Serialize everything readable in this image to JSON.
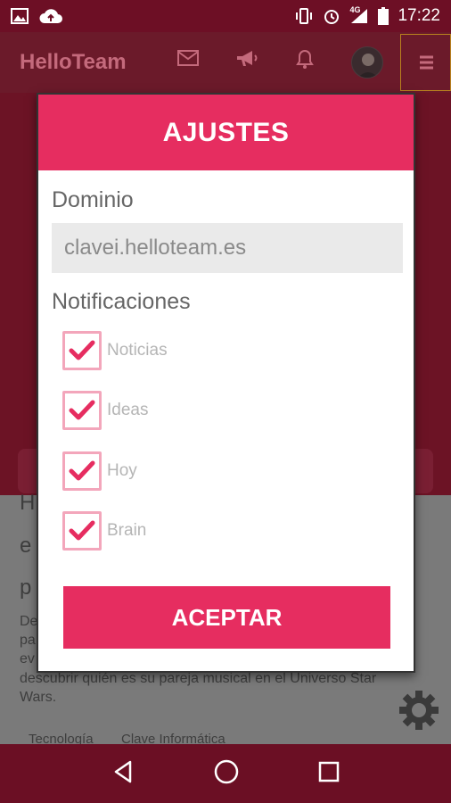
{
  "status_bar": {
    "time": "17:22",
    "network": "4G",
    "left_icons": [
      "image-icon",
      "cloud-upload-icon"
    ],
    "right_icons": [
      "vibrate-icon",
      "alarm-icon",
      "signal-icon",
      "battery-icon"
    ]
  },
  "app_bar": {
    "brand": "HelloTeam",
    "icons": [
      "mail-icon",
      "megaphone-icon",
      "bell-icon",
      "avatar",
      "menu-icon"
    ]
  },
  "background": {
    "lines": [
      "H",
      "e",
      "p",
      "De",
      "pa",
      "ev",
      "descubrir quién es su pareja musical en el Universo Star",
      "Wars."
    ],
    "tags": [
      "Tecnología",
      "Clave Informática"
    ]
  },
  "dialog": {
    "title": "AJUSTES",
    "domain_label": "Dominio",
    "domain_value": "clavei.helloteam.es",
    "notifications_label": "Notificaciones",
    "options": [
      {
        "label": "Noticias",
        "checked": true
      },
      {
        "label": "Ideas",
        "checked": true
      },
      {
        "label": "Hoy",
        "checked": true
      },
      {
        "label": "Brain",
        "checked": true
      }
    ],
    "accept": "ACEPTAR"
  },
  "colors": {
    "accent": "#e62d60",
    "checkbox_border": "#f3a6bb",
    "bar": "#6b0f24"
  }
}
